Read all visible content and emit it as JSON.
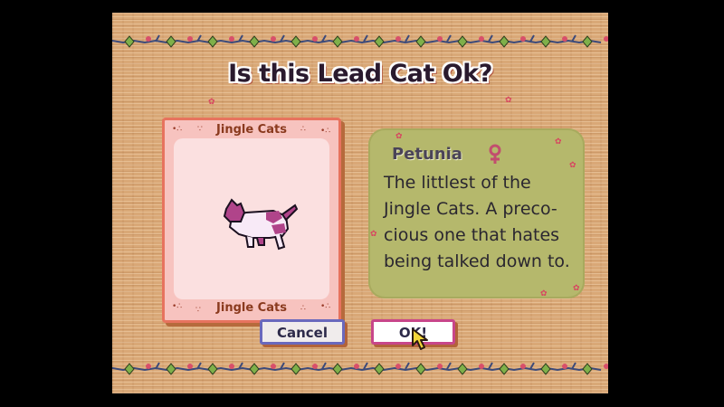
{
  "dialog": {
    "title": "Is this Lead Cat Ok?"
  },
  "card": {
    "caption_top": "Jingle Cats",
    "caption_bottom": "Jingle Cats",
    "portrait_icon": "white-pink-cat-sprite"
  },
  "cat_info": {
    "name": "Petunia",
    "gender_icon": "female-symbol",
    "description": "The littlest of the\nJingle Cats. A preco-\ncious one that hates\nbeing talked down to."
  },
  "buttons": {
    "cancel_label": "Cancel",
    "ok_label": "OK!"
  },
  "colors": {
    "background": "#d9a877",
    "card_border": "#e7735e",
    "panel": "#b5b86c",
    "cancel_border": "#6a69bd",
    "ok_border": "#c8468a",
    "cursor": "#f2d63a"
  }
}
